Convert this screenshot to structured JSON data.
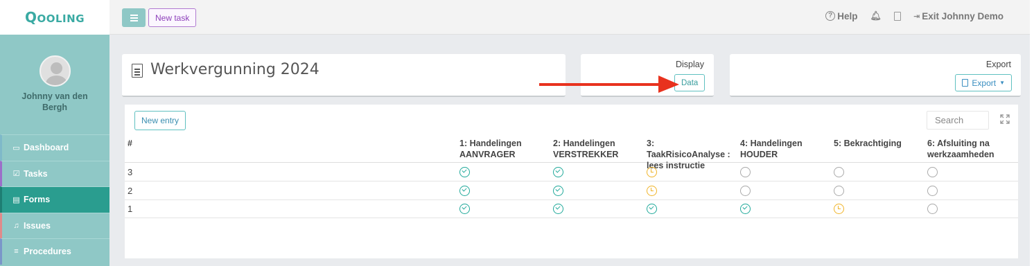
{
  "app": {
    "logo": "Qooling",
    "user_name": "Johnny van den Bergh"
  },
  "nav": {
    "items": [
      {
        "label": "Dashboard",
        "icon": "monitor-icon"
      },
      {
        "label": "Tasks",
        "icon": "check-square-icon"
      },
      {
        "label": "Forms",
        "icon": "document-icon",
        "active": true
      },
      {
        "label": "Issues",
        "icon": "bell-icon"
      },
      {
        "label": "Procedures",
        "icon": "list-icon"
      }
    ]
  },
  "topbar": {
    "new_task": "New task",
    "help": "Help",
    "exit": "Exit Johnny Demo"
  },
  "form": {
    "title": "Werkvergunning 2024"
  },
  "display": {
    "label": "Display",
    "data_button": "Data"
  },
  "export": {
    "label": "Export",
    "button": "Export"
  },
  "table": {
    "new_entry": "New entry",
    "search_placeholder": "Search",
    "columns": [
      "#",
      "1: Handelingen AANVRAGER",
      "2: Handelingen VERSTREKKER",
      "3: TaakRisicoAnalyse : lees instructie",
      "4: Handelingen HOUDER",
      "5: Bekrachtiging",
      "6: Afsluiting na werkzaamheden"
    ],
    "rows": [
      {
        "num": "3",
        "statuses": [
          "done",
          "done",
          "pending",
          "empty",
          "empty",
          "empty"
        ]
      },
      {
        "num": "2",
        "statuses": [
          "done",
          "done",
          "pending",
          "empty",
          "empty",
          "empty"
        ]
      },
      {
        "num": "1",
        "statuses": [
          "done",
          "done",
          "done",
          "done",
          "pending",
          "empty"
        ]
      }
    ]
  },
  "colors": {
    "accent": "#2a9d8f",
    "sidebar": "#8fc8c6",
    "done": "#20a99a",
    "pending": "#f0b429",
    "arrow": "#e8321e"
  }
}
